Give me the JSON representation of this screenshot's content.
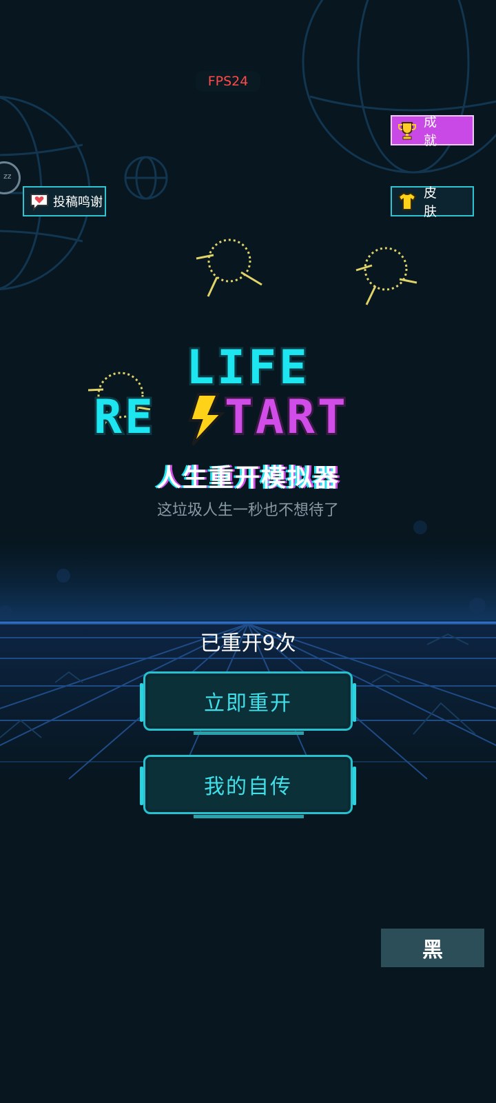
{
  "status": {
    "fps": "FPS24"
  },
  "top_buttons": {
    "achievements": "成 就",
    "credits": "投稿鸣谢",
    "skins": "皮 肤"
  },
  "logo": {
    "line1": "LIFE",
    "line2_left": "RE",
    "line2_right": "TART",
    "colors": {
      "cyan": "#1ee6f0",
      "purple": "#d04de8",
      "bolt": "#ffd21a"
    }
  },
  "title_cn": "人生重开模拟器",
  "subtitle": "这垃圾人生一秒也不想待了",
  "restart_count": "已重开9次",
  "buttons": {
    "restart": "立即重开",
    "autobiography": "我的自传",
    "theme": "黑"
  }
}
